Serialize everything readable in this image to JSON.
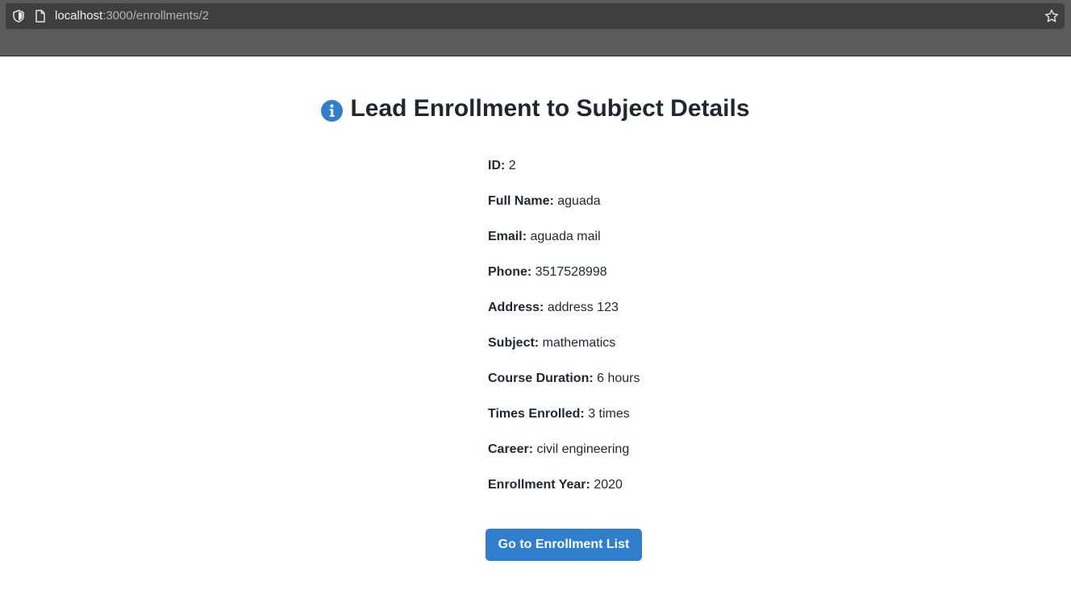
{
  "browser": {
    "url_host": "localhost",
    "url_rest": ":3000/enrollments/2"
  },
  "page": {
    "title": "Lead Enrollment to Subject Details",
    "button_label": "Go to Enrollment List"
  },
  "details": [
    {
      "label": "ID:",
      "value": "2"
    },
    {
      "label": "Full Name:",
      "value": "aguada"
    },
    {
      "label": "Email:",
      "value": "aguada mail"
    },
    {
      "label": "Phone:",
      "value": "3517528998"
    },
    {
      "label": "Address:",
      "value": "address 123"
    },
    {
      "label": "Subject:",
      "value": "mathematics"
    },
    {
      "label": "Course Duration:",
      "value": "6 hours"
    },
    {
      "label": "Times Enrolled:",
      "value": "3 times"
    },
    {
      "label": "Career:",
      "value": "civil engineering"
    },
    {
      "label": "Enrollment Year:",
      "value": "2020"
    }
  ],
  "colors": {
    "accent": "#2f7fcc",
    "text": "#1f2733"
  },
  "icons": {
    "shield": "shield-icon",
    "page": "page-icon",
    "star": "bookmark-star-icon",
    "info": "info-icon"
  }
}
